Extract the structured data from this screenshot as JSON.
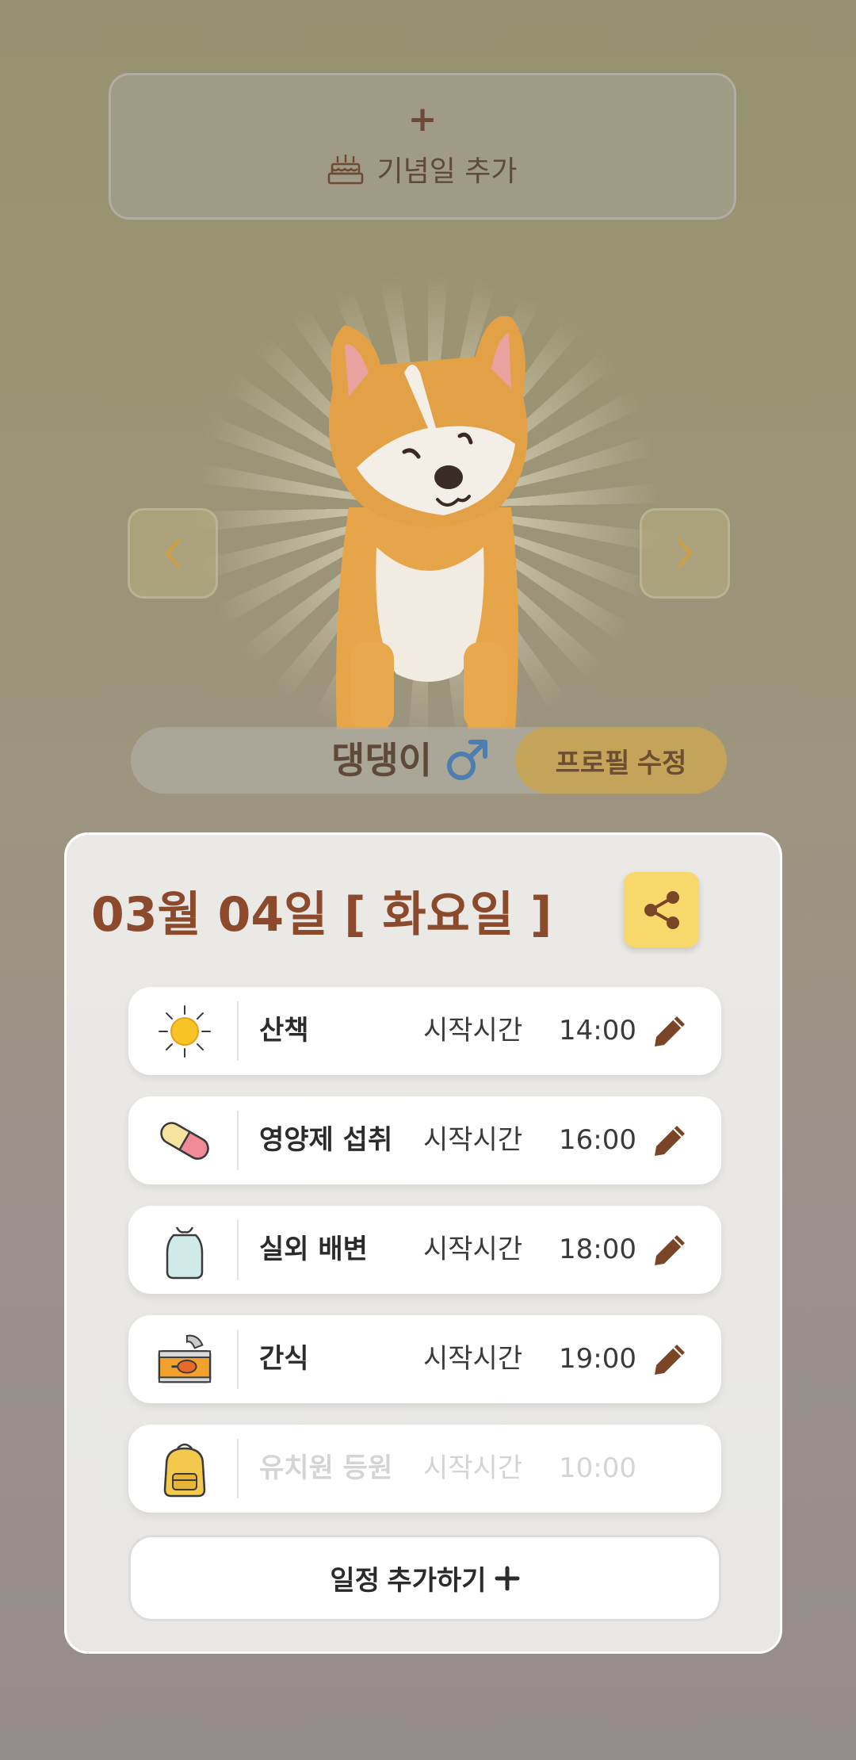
{
  "anniversary": {
    "plus": "+",
    "label": "기념일 추가"
  },
  "pet": {
    "name": "댕댕이",
    "gender_symbol": "♂",
    "edit_label": "프로필 수정"
  },
  "schedule": {
    "date_title": "03월 04일 [ 화요일 ]",
    "items": [
      {
        "icon": "sun-icon",
        "name": "산책",
        "start_label": "시작시간",
        "time": "14:00",
        "enabled": true
      },
      {
        "icon": "pill-icon",
        "name": "영양제 섭취",
        "start_label": "시작시간",
        "time": "16:00",
        "enabled": true
      },
      {
        "icon": "waste-bag-icon",
        "name": "실외 배변",
        "start_label": "시작시간",
        "time": "18:00",
        "enabled": true
      },
      {
        "icon": "food-can-icon",
        "name": "간식",
        "start_label": "시작시간",
        "time": "19:00",
        "enabled": true
      },
      {
        "icon": "backpack-icon",
        "name": "유치원 등원",
        "start_label": "시작시간",
        "time": "10:00",
        "enabled": false
      }
    ],
    "add_label": "일정 추가하기"
  },
  "colors": {
    "accent_brown": "#8a4a2b",
    "share_yellow": "#f8d86b",
    "edit_gold": "#c4a35a"
  }
}
